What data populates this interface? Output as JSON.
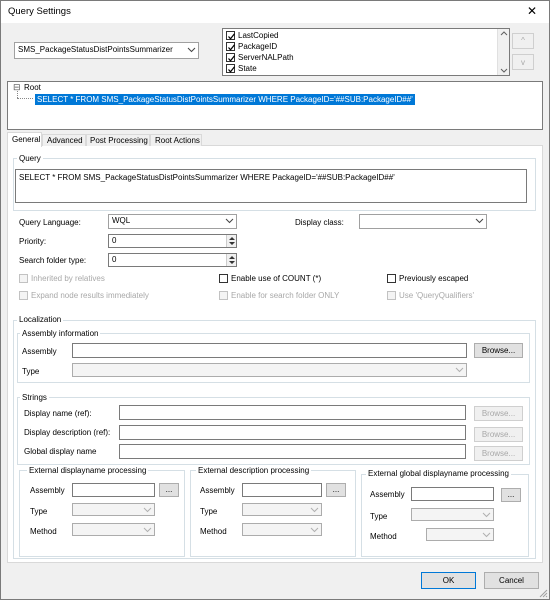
{
  "window": {
    "title": "Query Settings",
    "close_glyph": "✕"
  },
  "class_combo": {
    "value": "SMS_PackageStatusDistPointsSummarizer"
  },
  "columns_list": {
    "items": [
      {
        "label": "LastCopied",
        "checked": true
      },
      {
        "label": "PackageID",
        "checked": true
      },
      {
        "label": "ServerNALPath",
        "checked": true
      },
      {
        "label": "State",
        "checked": true
      }
    ]
  },
  "move_buttons": {
    "up": "^",
    "down": "v"
  },
  "tree": {
    "root_label": "Root",
    "expander": "⊟",
    "child_label": "SELECT * FROM SMS_PackageStatusDistPointsSummarizer WHERE PackageID='##SUB:PackageID##'"
  },
  "tabs": [
    {
      "label": "General",
      "active": true
    },
    {
      "label": "Advanced",
      "active": false
    },
    {
      "label": "Post Processing",
      "active": false
    },
    {
      "label": "Root Actions",
      "active": false
    }
  ],
  "general": {
    "query_group_label": "Query",
    "query_text": "SELECT * FROM SMS_PackageStatusDistPointsSummarizer WHERE PackageID='##SUB:PackageID##'",
    "query_language_label": "Query Language:",
    "query_language_value": "WQL",
    "display_class_label": "Display class:",
    "display_class_value": "",
    "priority_label": "Priority:",
    "priority_value": "0",
    "search_folder_type_label": "Search folder type:",
    "search_folder_type_value": "0",
    "checkboxes": {
      "inherited": "Inherited by relatives",
      "enable_count": "Enable use of COUNT (*)",
      "previously_escaped": "Previously escaped",
      "expand_node": "Expand node results immediately",
      "enable_search_folder": "Enable for search folder ONLY",
      "use_query_qualifiers": "Use 'QueryQualifiers'"
    }
  },
  "localization": {
    "group_label": "Localization",
    "assembly_info_label": "Assembly information",
    "assembly_label": "Assembly",
    "type_label": "Type",
    "browse_label": "Browse...",
    "strings_label": "Strings",
    "display_name_label": "Display name (ref):",
    "display_description_label": "Display description (ref):",
    "global_display_name_label": "Global display name",
    "ext_displayname_label": "External displayname processing",
    "ext_description_label": "External description processing",
    "ext_global_label": "External global displayname processing",
    "method_label": "Method",
    "ellipsis": "..."
  },
  "footer": {
    "ok": "OK",
    "cancel": "Cancel"
  }
}
